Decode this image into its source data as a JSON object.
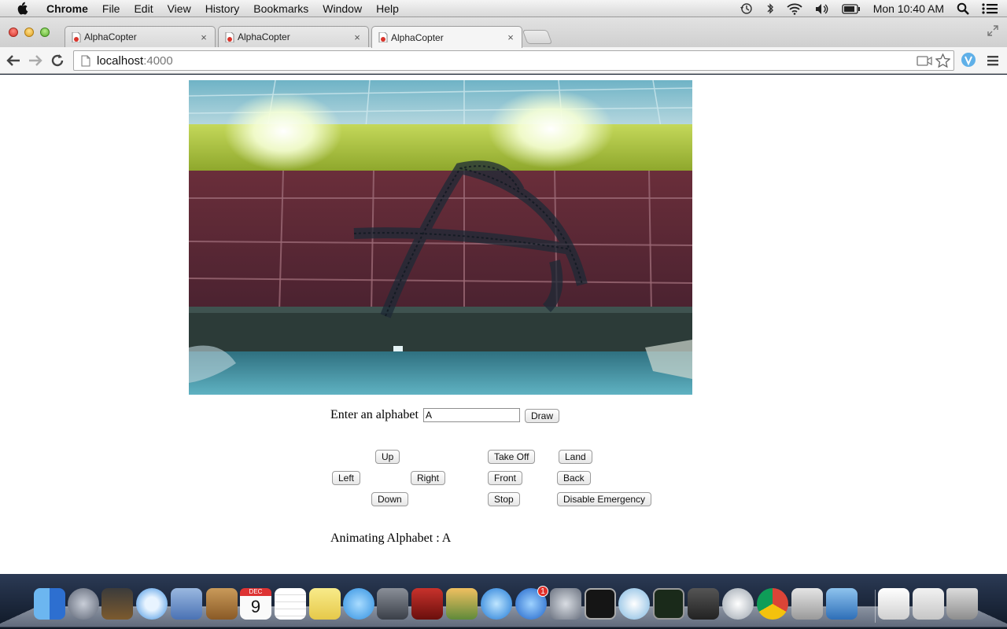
{
  "menubar": {
    "app_name": "Chrome",
    "items": [
      "File",
      "Edit",
      "View",
      "History",
      "Bookmarks",
      "Window",
      "Help"
    ],
    "clock": "Mon 10:40 AM"
  },
  "browser": {
    "tabs": [
      {
        "title": "AlphaCopter",
        "active": false
      },
      {
        "title": "AlphaCopter",
        "active": false
      },
      {
        "title": "AlphaCopter",
        "active": true
      }
    ],
    "close_glyph": "×",
    "url_host": "localhost",
    "url_port": ":4000"
  },
  "page": {
    "input_label": "Enter an alphabet",
    "input_value": "A",
    "draw_label": "Draw",
    "controls": {
      "up": "Up",
      "left": "Left",
      "right": "Right",
      "down": "Down",
      "take_off": "Take Off",
      "land": "Land",
      "front": "Front",
      "back": "Back",
      "stop": "Stop",
      "disable_emergency": "Disable Emergency"
    },
    "status_text": "Animating Alphabet : A"
  },
  "dock": {
    "badge_count": "1",
    "calendar_month": "DEC",
    "calendar_day": "9",
    "icons": [
      "finder-icon",
      "launchpad-icon",
      "photo-booth-icon",
      "safari-icon",
      "mail-icon",
      "contacts-icon",
      "calendar-icon",
      "reminders-icon",
      "notes-icon",
      "messages-icon",
      "facetime-icon",
      "photo-browser-icon",
      "iphoto-icon",
      "itunes-icon",
      "app-store-icon",
      "system-preferences-icon",
      "terminal-icon",
      "app-icon",
      "activity-monitor-icon",
      "sublime-text-icon",
      "app-icon",
      "chrome-icon",
      "calculator-icon",
      "xcode-icon",
      "archive-icon",
      "mamp-icon",
      "trash-icon"
    ]
  },
  "colors": {
    "page_bg": "#ffffff",
    "wall_red": "#5c2430",
    "ceiling_green": "#a8c63a",
    "floor_teal": "#3c8fa0"
  }
}
